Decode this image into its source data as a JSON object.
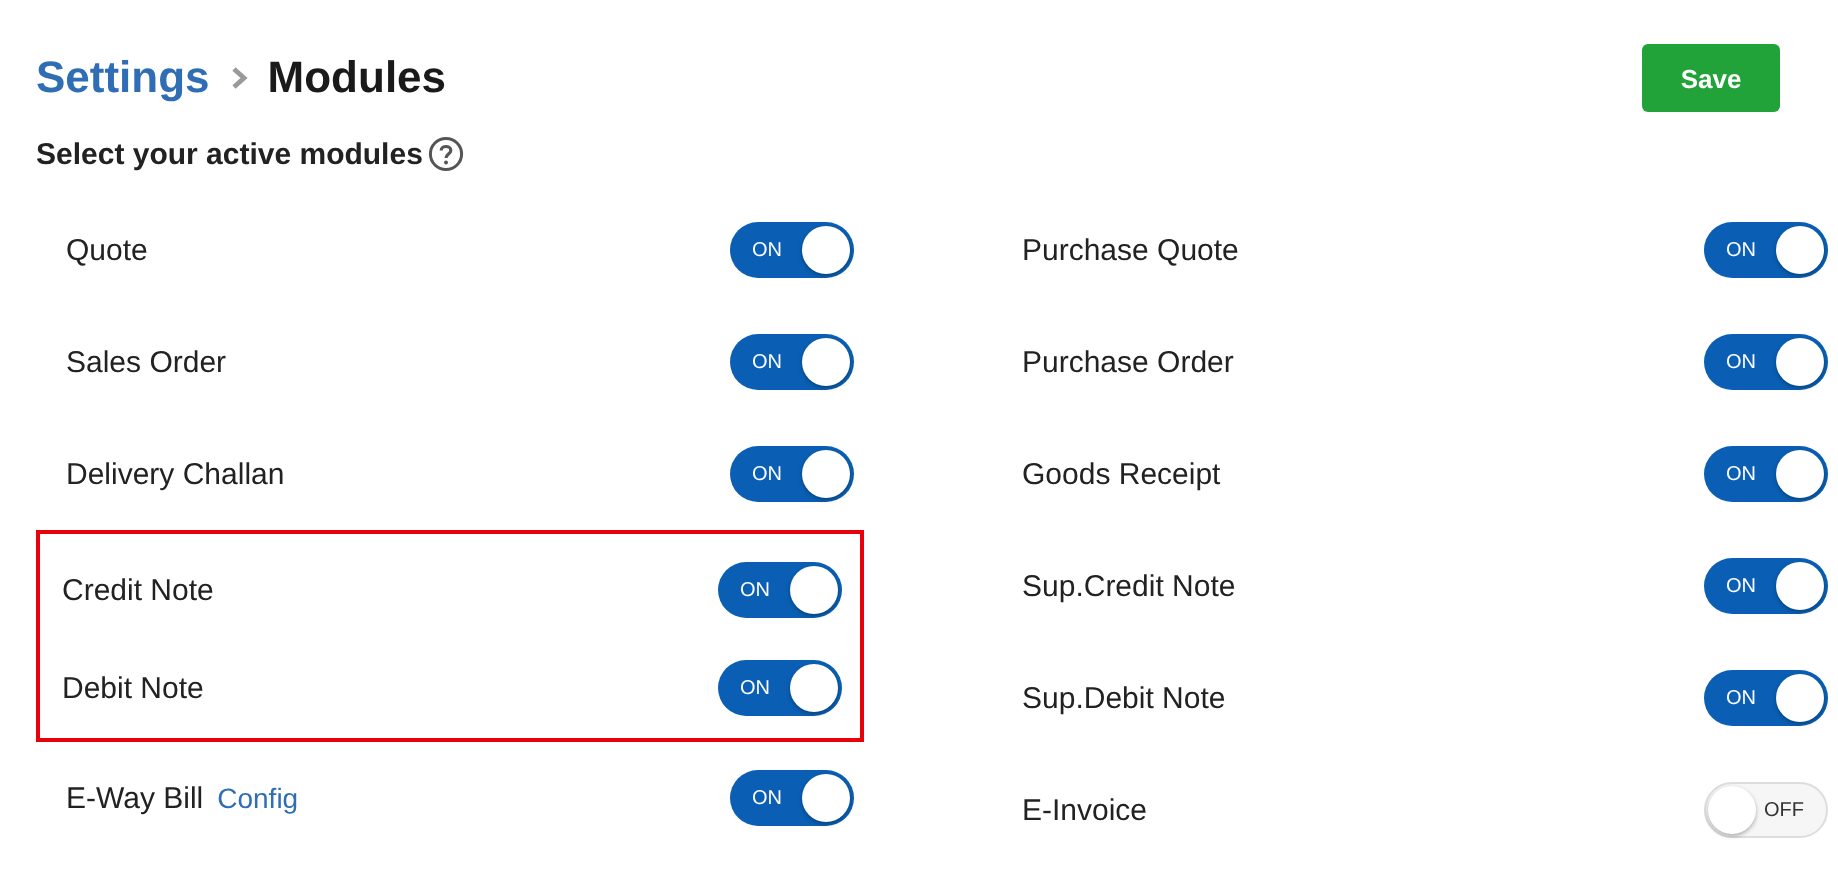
{
  "breadcrumb": {
    "parent": "Settings",
    "current": "Modules"
  },
  "save_button": "Save",
  "section_title": "Select your active modules",
  "columns": [
    {
      "modules": [
        {
          "label": "Quote",
          "on": true,
          "toggle_text": "ON",
          "highlighted": false
        },
        {
          "label": "Sales Order",
          "on": true,
          "toggle_text": "ON",
          "highlighted": false
        },
        {
          "label": "Delivery Challan",
          "on": true,
          "toggle_text": "ON",
          "highlighted": false
        },
        {
          "label": "Credit Note",
          "on": true,
          "toggle_text": "ON",
          "highlighted": true
        },
        {
          "label": "Debit Note",
          "on": true,
          "toggle_text": "ON",
          "highlighted": true
        },
        {
          "label": "E-Way Bill",
          "link": "Config",
          "on": true,
          "toggle_text": "ON",
          "highlighted": false
        }
      ]
    },
    {
      "modules": [
        {
          "label": "Purchase Quote",
          "on": true,
          "toggle_text": "ON",
          "highlighted": false
        },
        {
          "label": "Purchase Order",
          "on": true,
          "toggle_text": "ON",
          "highlighted": false
        },
        {
          "label": "Goods Receipt",
          "on": true,
          "toggle_text": "ON",
          "highlighted": false
        },
        {
          "label": "Sup.Credit Note",
          "on": true,
          "toggle_text": "ON",
          "highlighted": false
        },
        {
          "label": "Sup.Debit Note",
          "on": true,
          "toggle_text": "ON",
          "highlighted": false
        },
        {
          "label": "E-Invoice",
          "on": false,
          "toggle_text": "OFF",
          "highlighted": false
        }
      ]
    }
  ]
}
